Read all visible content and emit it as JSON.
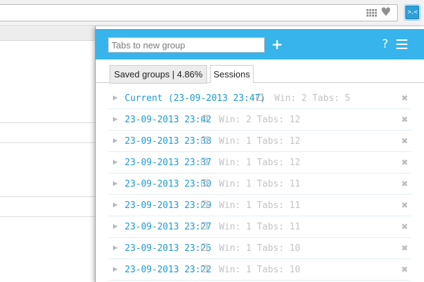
{
  "toolbar": {
    "icons": [
      "grid-icon",
      "heart-icon"
    ],
    "extension_button_label": ">.<"
  },
  "popup": {
    "input_placeholder": "Tabs to new group",
    "add_label": "+",
    "help_label": "?",
    "menu_icon": "hamburger-icon",
    "accent_color": "#36b4eb",
    "tabs": [
      {
        "label": "Saved groups | 4.86%",
        "active": false
      },
      {
        "label": "Sessions",
        "active": true
      }
    ],
    "delete_glyph": "✖",
    "sessions": [
      {
        "label": "Current (23-09-2013 23:47)",
        "info": "Win: 2 Tabs: 5"
      },
      {
        "label": "23-09-2013 23:42",
        "info": "Win: 2 Tabs: 12"
      },
      {
        "label": "23-09-2013 23:38",
        "info": "Win: 1 Tabs: 12"
      },
      {
        "label": "23-09-2013 23:37",
        "info": "Win: 1 Tabs: 12"
      },
      {
        "label": "23-09-2013 23:30",
        "info": "Win: 1 Tabs: 11"
      },
      {
        "label": "23-09-2013 23:29",
        "info": "Win: 1 Tabs: 11"
      },
      {
        "label": "23-09-2013 23:27",
        "info": "Win: 1 Tabs: 11"
      },
      {
        "label": "23-09-2013 23:25",
        "info": "Win: 1 Tabs: 10"
      },
      {
        "label": "23-09-2013 23:22",
        "info": "Win: 1 Tabs: 10"
      }
    ]
  }
}
